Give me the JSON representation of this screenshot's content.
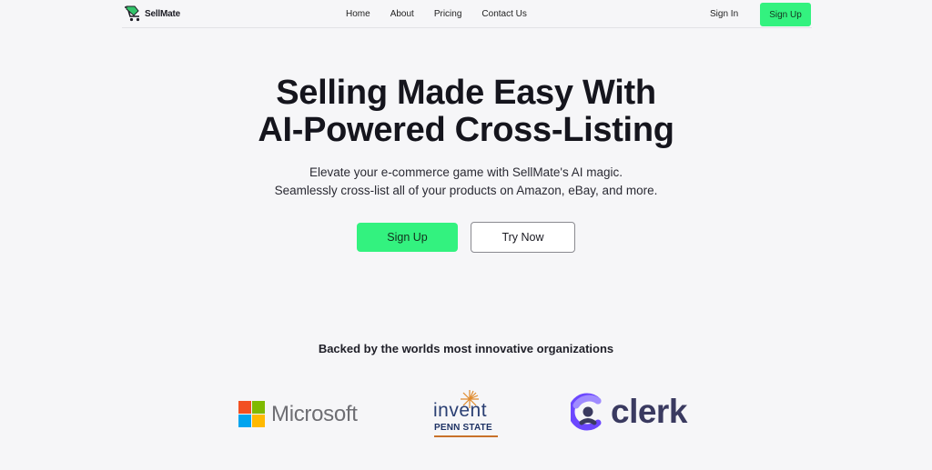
{
  "brand": {
    "name": "SellMate",
    "icon": "cart-tag-logo",
    "accent": "#33f27f"
  },
  "nav": {
    "links": [
      "Home",
      "About",
      "Pricing",
      "Contact Us"
    ],
    "sign_in": "Sign In",
    "sign_up": "Sign Up"
  },
  "hero": {
    "title_line1": "Selling Made Easy With",
    "title_line2": "AI-Powered Cross-Listing",
    "subtitle_line1": "Elevate your e-commerce game with SellMate's AI magic.",
    "subtitle_line2": "Seamlessly cross-list all of your products on Amazon, eBay, and more.",
    "primary_button": "Sign Up",
    "secondary_button": "Try Now"
  },
  "backers": {
    "heading": "Backed by the worlds most innovative organizations",
    "logos": [
      {
        "name": "Microsoft",
        "icon": "microsoft-logo"
      },
      {
        "name": "invent",
        "sub": "PENN STATE",
        "icon": "invent-penn-state-logo"
      },
      {
        "name": "clerk",
        "icon": "clerk-logo"
      }
    ]
  }
}
